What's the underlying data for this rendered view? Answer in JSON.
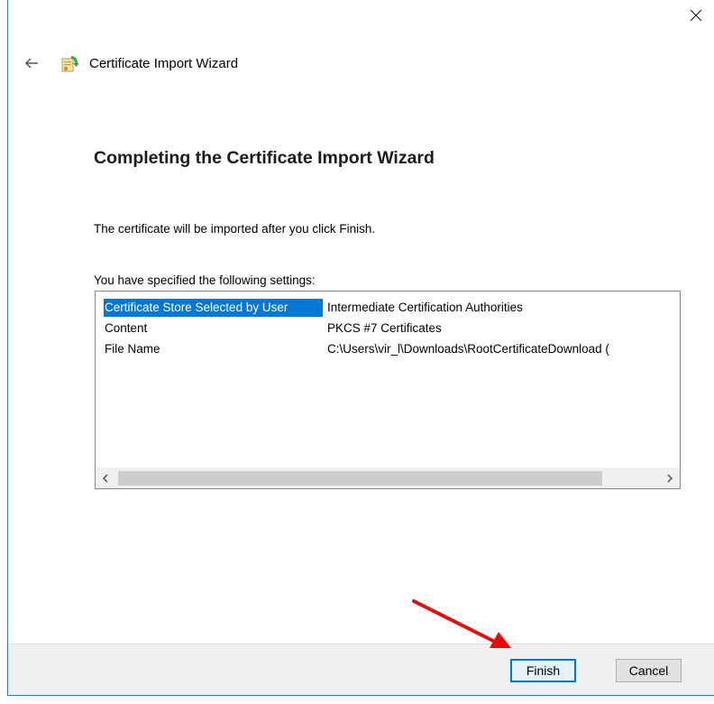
{
  "window": {
    "close_glyph": "✕"
  },
  "header": {
    "title": "Certificate Import Wizard",
    "back_icon": "back-arrow-icon",
    "app_icon": "certificate-wizard-icon"
  },
  "page": {
    "heading": "Completing the Certificate Import Wizard",
    "intro": "The certificate will be imported after you click Finish.",
    "settings_label": "You have specified the following settings:"
  },
  "settings": {
    "rows": [
      {
        "name": "Certificate Store Selected by User",
        "value": "Intermediate Certification Authorities",
        "selected": true
      },
      {
        "name": "Content",
        "value": "PKCS #7 Certificates",
        "selected": false
      },
      {
        "name": "File Name",
        "value": "C:\\Users\\vir_l\\Downloads\\RootCertificateDownload (",
        "selected": false
      }
    ]
  },
  "scrollbar": {
    "left_glyph": "‹",
    "right_glyph": "›"
  },
  "footer": {
    "finish_label": "Finish",
    "cancel_label": "Cancel"
  },
  "colors": {
    "accent": "#0078d7",
    "annotation_arrow": "#e01010",
    "footer_bg": "#f0f0f0"
  }
}
